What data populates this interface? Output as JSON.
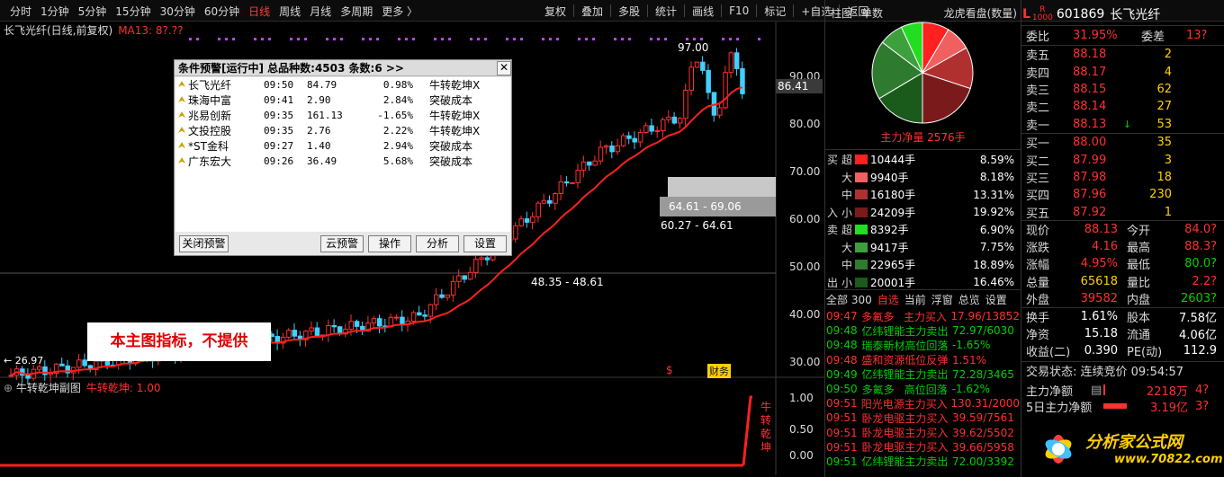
{
  "toolbar": {
    "left": [
      "分时",
      "1分钟",
      "5分钟",
      "15分钟",
      "30分钟",
      "60分钟",
      "日线",
      "周线",
      "月线",
      "多周期",
      "更多 〉"
    ],
    "right": [
      "复权",
      "叠加",
      "多股",
      "统计",
      "画线",
      "F10",
      "标记",
      "+自选",
      "返回"
    ],
    "active_index": 6
  },
  "chart": {
    "title": "长飞光纤(日线,前复权)",
    "ma": "MA13: 8?.??",
    "y_labels": [
      "90.00",
      "80.00",
      "70.00",
      "60.00",
      "50.00",
      "40.00",
      "30.00"
    ],
    "current_price": "86.41",
    "high_label": "97.00",
    "range_labels": [
      "64.61 - 69.06",
      "60.27 - 64.61",
      "48.35 - 48.61"
    ],
    "bottom_left": "26.97",
    "signals": [
      "$",
      "财务"
    ]
  },
  "alarm": {
    "title": "条件预警[运行中] 总品种数:4503 条数:6  >>",
    "rows": [
      {
        "name": "长飞光纤",
        "time": "09:50",
        "price": "84.79",
        "chg": "0.98%",
        "signal": "牛转乾坤X"
      },
      {
        "name": "珠海中富",
        "time": "09:41",
        "price": "2.90",
        "chg": "2.84%",
        "signal": "突破成本"
      },
      {
        "name": "兆易创新",
        "time": "09:35",
        "price": "161.13",
        "chg": "-1.65%",
        "signal": "牛转乾坤X"
      },
      {
        "name": "文投控股",
        "time": "09:35",
        "price": "2.76",
        "chg": "2.22%",
        "signal": "牛转乾坤X"
      },
      {
        "name": "*ST金科",
        "time": "09:27",
        "price": "1.40",
        "chg": "2.94%",
        "signal": "突破成本"
      },
      {
        "name": "广东宏大",
        "time": "09:26",
        "price": "36.49",
        "chg": "5.68%",
        "signal": "突破成本"
      }
    ],
    "buttons": [
      "关闭预警",
      "云预警",
      "操作",
      "分析",
      "设置"
    ]
  },
  "main_indicator_note": "本主图指标，不提供",
  "sub_chart": {
    "title": "牛转乾坤副图",
    "value_label": "牛转乾坤: 1.00",
    "y_labels": [
      "1.00",
      "0.50",
      "0.00"
    ],
    "side_text": "牛转乾坤"
  },
  "pie_panel": {
    "tabs": [
      "柱图",
      "单数"
    ],
    "title": "龙虎看盘(数量)",
    "net_label": "主力净量 2576手",
    "slices": [
      {
        "value": 0.0859,
        "color": "#ff2020"
      },
      {
        "value": 0.0818,
        "color": "#f06060"
      },
      {
        "value": 0.1331,
        "color": "#b03030"
      },
      {
        "value": 0.1992,
        "color": "#7a1a1a"
      },
      {
        "value": 0.1646,
        "color": "#1a5a1a"
      },
      {
        "value": 0.1889,
        "color": "#2e7a2e"
      },
      {
        "value": 0.0775,
        "color": "#3ca03c"
      },
      {
        "value": 0.069,
        "color": "#22dd22"
      }
    ]
  },
  "flow": [
    {
      "side": "买",
      "cat": "超",
      "hand": "10444手",
      "pct": "8.59%",
      "color": "#ff2020"
    },
    {
      "side": "",
      "cat": "大",
      "hand": "9940手",
      "pct": "8.18%",
      "color": "#f06060"
    },
    {
      "side": "",
      "cat": "中",
      "hand": "16180手",
      "pct": "13.31%",
      "color": "#b03030"
    },
    {
      "side": "入",
      "cat": "小",
      "hand": "24209手",
      "pct": "19.92%",
      "color": "#7a1a1a"
    },
    {
      "side": "卖",
      "cat": "超",
      "hand": "8392手",
      "pct": "6.90%",
      "color": "#22dd22"
    },
    {
      "side": "",
      "cat": "大",
      "hand": "9417手",
      "pct": "7.75%",
      "color": "#3ca03c"
    },
    {
      "side": "",
      "cat": "中",
      "hand": "22965手",
      "pct": "18.89%",
      "color": "#2e7a2e"
    },
    {
      "side": "出",
      "cat": "小",
      "hand": "20001手",
      "pct": "16.46%",
      "color": "#1a5a1a"
    }
  ],
  "midtabs": {
    "items": [
      "全部 300",
      "自选",
      "当前",
      "浮窗",
      "总览",
      "设置"
    ],
    "active_index": 1
  },
  "ticker": [
    {
      "time": "09:47",
      "name": "多氟多",
      "type": "主力买入",
      "val": "17.96/13852",
      "color": "#ff3030"
    },
    {
      "time": "09:48",
      "name": "亿纬锂能",
      "type": "主力卖出",
      "val": "72.97/6030",
      "color": "#00d000"
    },
    {
      "time": "09:48",
      "name": "瑞泰新材",
      "type": "高位回落",
      "val": "-1.65%",
      "color": "#00d000"
    },
    {
      "time": "09:48",
      "name": "盛和资源",
      "type": "低位反弹",
      "val": "1.51%",
      "color": "#ff3030"
    },
    {
      "time": "09:49",
      "name": "亿纬锂能",
      "type": "主力卖出",
      "val": "72.28/3465",
      "color": "#00d000"
    },
    {
      "time": "09:50",
      "name": "多氟多",
      "type": "高位回落",
      "val": "-1.62%",
      "color": "#00d000"
    },
    {
      "time": "09:51",
      "name": "阳光电源",
      "type": "主力买入",
      "val": "130.31/2000",
      "color": "#ff3030"
    },
    {
      "time": "09:51",
      "name": "卧龙电驱",
      "type": "主力买入",
      "val": "39.59/7561",
      "color": "#ff3030"
    },
    {
      "time": "09:51",
      "name": "卧龙电驱",
      "type": "主力买入",
      "val": "39.62/5502",
      "color": "#ff3030"
    },
    {
      "time": "09:51",
      "name": "卧龙电驱",
      "type": "主力买入",
      "val": "39.66/5958",
      "color": "#ff3030"
    },
    {
      "time": "09:51",
      "name": "亿纬锂能",
      "type": "主力卖出",
      "val": "72.00/3392",
      "color": "#00d000"
    }
  ],
  "stock": {
    "code": "601869",
    "name": "长飞光纤",
    "badge_l": "L",
    "badge_r": "R"
  },
  "weibi": {
    "label": "委比",
    "value": "31.95%",
    "label2": "委差",
    "value2": "13?"
  },
  "asks": [
    {
      "label": "卖五",
      "price": "88.18",
      "vol": "2",
      "arrow": ""
    },
    {
      "label": "卖四",
      "price": "88.17",
      "vol": "4",
      "arrow": ""
    },
    {
      "label": "卖三",
      "price": "88.15",
      "vol": "62",
      "arrow": ""
    },
    {
      "label": "卖二",
      "price": "88.14",
      "vol": "27",
      "arrow": ""
    },
    {
      "label": "卖一",
      "price": "88.13",
      "vol": "53",
      "arrow": "↓"
    }
  ],
  "bids": [
    {
      "label": "买一",
      "price": "88.00",
      "vol": "35",
      "arrow": ""
    },
    {
      "label": "买二",
      "price": "87.99",
      "vol": "3",
      "arrow": ""
    },
    {
      "label": "买三",
      "price": "87.98",
      "vol": "18",
      "arrow": ""
    },
    {
      "label": "买四",
      "price": "87.96",
      "vol": "230",
      "arrow": ""
    },
    {
      "label": "买五",
      "price": "87.92",
      "vol": "1",
      "arrow": ""
    }
  ],
  "stats": [
    {
      "l1": "现价",
      "v1": "88.13",
      "c1": "red",
      "l2": "今开",
      "v2": "84.0?",
      "c2": "red"
    },
    {
      "l1": "涨跌",
      "v1": "4.16",
      "c1": "red",
      "l2": "最高",
      "v2": "88.3?",
      "c2": "red"
    },
    {
      "l1": "涨幅",
      "v1": "4.95%",
      "c1": "red",
      "l2": "最低",
      "v2": "80.0?",
      "c2": "green"
    },
    {
      "l1": "总量",
      "v1": "65618",
      "c1": "yellow",
      "l2": "量比",
      "v2": "2.2?",
      "c2": "red"
    },
    {
      "l1": "外盘",
      "v1": "39582",
      "c1": "red",
      "l2": "内盘",
      "v2": "2603?",
      "c2": "green"
    }
  ],
  "stats2": [
    {
      "l1": "换手",
      "v1": "1.61%",
      "c1": "white",
      "l2": "股本",
      "v2": "7.58亿",
      "c2": "white"
    },
    {
      "l1": "净资",
      "v1": "15.18",
      "c1": "white",
      "l2": "流通",
      "v2": "4.06亿",
      "c2": "white"
    },
    {
      "l1": "收益(二)",
      "v1": "0.390",
      "c1": "white",
      "l2": "PE(动)",
      "v2": "112.9",
      "c2": "white"
    }
  ],
  "trade_status": "交易状态: 连续竞价 09:54:57",
  "net_rows": [
    {
      "label": "主力净额",
      "value": "2218万",
      "pct": "4?"
    },
    {
      "label": "5日主力净额",
      "value": "3.19亿",
      "pct": "3?"
    }
  ],
  "logo": {
    "main": "分析家公式网",
    "url": "www.70822.com"
  }
}
